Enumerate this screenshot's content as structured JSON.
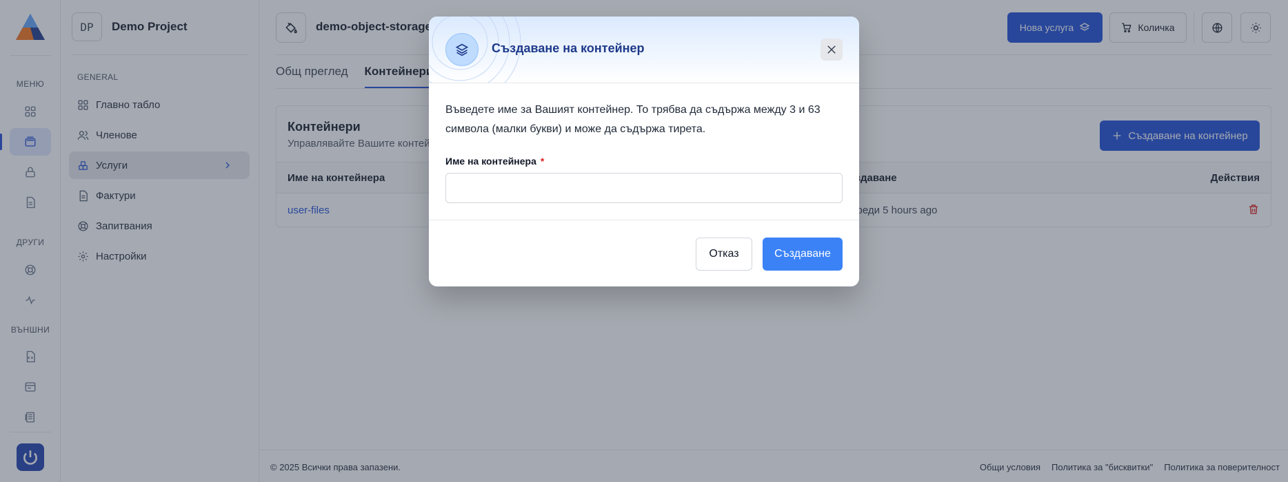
{
  "rail": {
    "sections": {
      "menu": "МЕНЮ",
      "other": "ДРУГИ",
      "external": "ВЪНШНИ"
    },
    "icons": [
      "grid-icon",
      "layers-icon",
      "lock-icon",
      "document-icon",
      "lifebuoy-icon",
      "activity-icon",
      "file-code-icon",
      "browser-icon",
      "ledger-icon",
      "power-icon"
    ]
  },
  "sidebar": {
    "project_initials": "DP",
    "project_name": "Demo Project",
    "group_label": "GENERAL",
    "items": [
      {
        "label": "Главно табло",
        "icon": "grid-icon"
      },
      {
        "label": "Членове",
        "icon": "users-icon"
      },
      {
        "label": "Услуги",
        "icon": "services-icon",
        "active": true
      },
      {
        "label": "Фактури",
        "icon": "invoice-icon"
      },
      {
        "label": "Запитвания",
        "icon": "lifebuoy-icon"
      },
      {
        "label": "Настройки",
        "icon": "gear-icon"
      }
    ]
  },
  "header": {
    "service_name": "demo-object-storage",
    "new_service_label": "Нова услуга",
    "cart_label": "Количка"
  },
  "tabs": [
    "Общ преглед",
    "Контейнери"
  ],
  "card": {
    "title": "Контейнери",
    "subtitle": "Управлявайте Вашите контейнери",
    "create_button": "Създаване на контейнер",
    "columns": {
      "name": "Име на контейнера",
      "created": "Дата на създаване",
      "actions": "Действия"
    },
    "rows": [
      {
        "name": "user-files",
        "created": "Създаден преди 5 hours ago"
      }
    ]
  },
  "footer": {
    "copyright": "© 2025 Всички права запазени.",
    "links": [
      "Общи условия",
      "Политика за \"бисквитки\"",
      "Политика за поверителност"
    ]
  },
  "modal": {
    "title": "Създаване на контейнер",
    "description": "Въведете име за Вашият контейнер. То трябва да съдържа между 3 и 63 символа (малки букви) и може да съдържа тирета.",
    "field_label": "Име на контейнера",
    "required_mark": "*",
    "field_value": "",
    "cancel_label": "Отказ",
    "submit_label": "Създаване"
  },
  "colors": {
    "primary": "#1d4ed8",
    "submit": "#3b82f6",
    "danger": "#dc2626"
  }
}
